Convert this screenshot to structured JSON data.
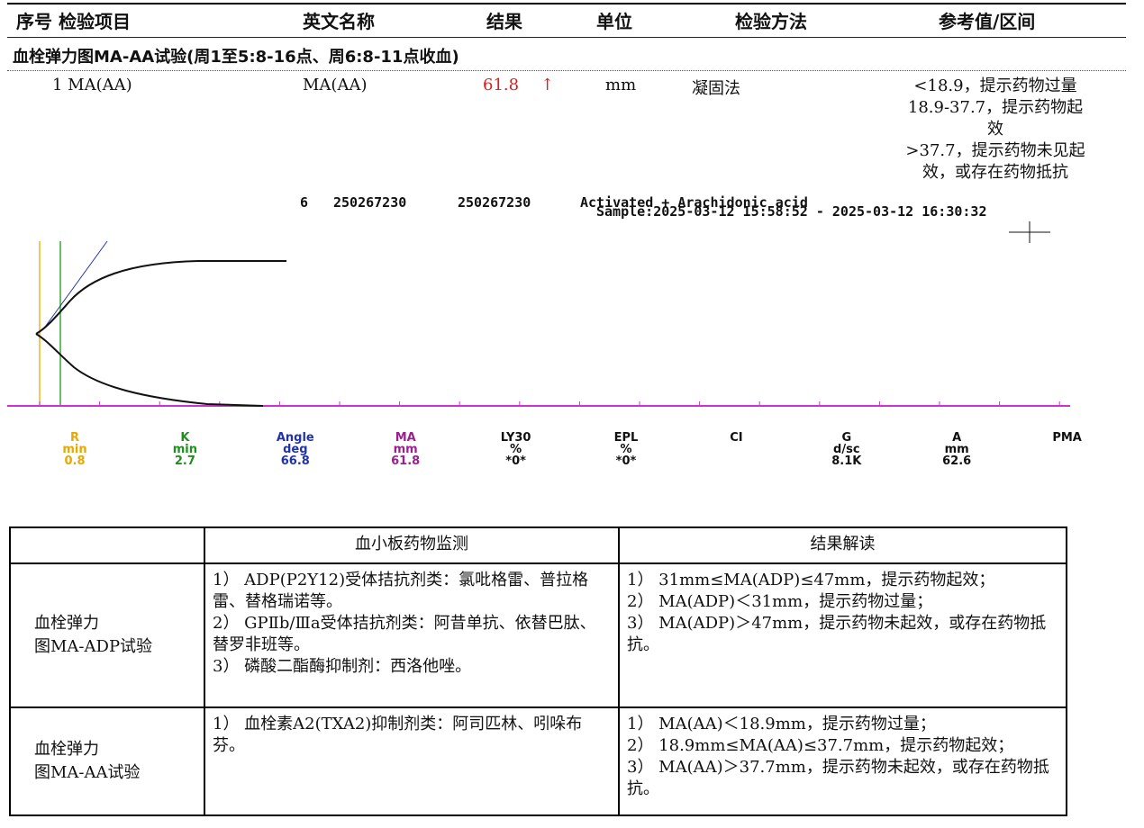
{
  "header": {
    "col_index_item": "序号 检验项目",
    "col_english": "英文名称",
    "col_result": "结果",
    "col_unit": "单位",
    "col_method": "检验方法",
    "col_reference": "参考值/区间"
  },
  "section_title": "血栓弹力图MA-AA试验(周1至5:8-16点、周6:8-11点收血)",
  "result_row": {
    "item": "1 MA(AA)",
    "english": "MA(AA)",
    "value": "61.8",
    "flag": "↑",
    "unit": "mm",
    "method": "凝固法",
    "reference_lines": [
      "<18.9，提示药物过量",
      "18.9-37.7，提示药物起",
      "效",
      ">37.7，提示药物未见起",
      "效，或存在药物抵抗"
    ]
  },
  "teg": {
    "channel": "6",
    "id1": "250267230",
    "id2": "250267230",
    "reagent": "Activated + Arachidonic acid",
    "sample_time": "Sample:2025-03-12 15:58:52 - 2025-03-12 16:30:32",
    "colors": {
      "r": "#e8b820",
      "k": "#33aa33",
      "angle": "#2233aa",
      "ma": "#aa2299",
      "baseline": "#cc33cc",
      "trace": "#111111"
    },
    "metrics": [
      {
        "name": "R",
        "unit": "min",
        "value": "0.8",
        "color": "#e8a800"
      },
      {
        "name": "K",
        "unit": "min",
        "value": "2.7",
        "color": "#1f8f1f"
      },
      {
        "name": "Angle",
        "unit": "deg",
        "value": "66.8",
        "color": "#2233aa"
      },
      {
        "name": "MA",
        "unit": "mm",
        "value": "61.8",
        "color": "#9b1f8f"
      },
      {
        "name": "LY30",
        "unit": "%",
        "value": "*0*",
        "color": "#111111"
      },
      {
        "name": "EPL",
        "unit": "%",
        "value": "*0*",
        "color": "#111111"
      },
      {
        "name": "CI",
        "unit": "",
        "value": "",
        "color": "#111111"
      },
      {
        "name": "G",
        "unit": "d/sc",
        "value": "8.1K",
        "color": "#111111"
      },
      {
        "name": "A",
        "unit": "mm",
        "value": "62.6",
        "color": "#111111"
      },
      {
        "name": "PMA",
        "unit": "",
        "value": "",
        "color": "#111111"
      }
    ]
  },
  "interpretation": {
    "header_monitor": "血小板药物监测",
    "header_reading": "结果解读",
    "rows": [
      {
        "category": [
          "血栓弹力",
          "图MA-ADP试验"
        ],
        "monitor": [
          "1） ADP(P2Y12)受体拮抗剂类：氯吡格雷、普拉格雷、替格瑞诺等。",
          "2） GPⅡb/Ⅲa受体拮抗剂类：阿昔单抗、依替巴肽、替罗非班等。",
          "3） 磷酸二酯酶抑制剂：西洛他唑。"
        ],
        "reading": [
          "1） 31mm≤MA(ADP)≤47mm，提示药物起效；",
          "2） MA(ADP)＜31mm，提示药物过量；",
          "3） MA(ADP)＞47mm，提示药物未起效，或存在药物抵抗。"
        ]
      },
      {
        "category": [
          "血栓弹力",
          "图MA-AA试验"
        ],
        "monitor": [
          "1） 血栓素A2(TXA2)抑制剂类：阿司匹林、吲哚布芬。"
        ],
        "reading": [
          "1） MA(AA)＜18.9mm，提示药物过量；",
          "2） 18.9mm≤MA(AA)≤37.7mm，提示药物起效；",
          "3） MA(AA)＞37.7mm，提示药物未起效，或存在药物抵抗。"
        ]
      }
    ]
  }
}
